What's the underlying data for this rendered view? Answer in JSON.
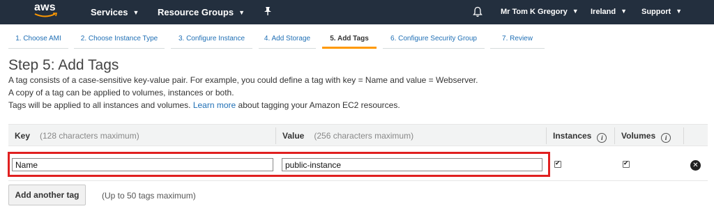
{
  "topnav": {
    "logo": "aws",
    "services": "Services",
    "resource_groups": "Resource Groups",
    "pin_icon": "pin-icon",
    "bell_icon": "bell-icon",
    "user": "Mr Tom K Gregory",
    "region": "Ireland",
    "support": "Support"
  },
  "tabs": [
    {
      "label": "1. Choose AMI"
    },
    {
      "label": "2. Choose Instance Type"
    },
    {
      "label": "3. Configure Instance"
    },
    {
      "label": "4. Add Storage"
    },
    {
      "label": "5. Add Tags"
    },
    {
      "label": "6. Configure Security Group"
    },
    {
      "label": "7. Review"
    }
  ],
  "heading": "Step 5: Add Tags",
  "description": {
    "line1": "A tag consists of a case-sensitive key-value pair. For example, you could define a tag with key = Name and value = Webserver.",
    "line2": "A copy of a tag can be applied to volumes, instances or both.",
    "line3_pre": "Tags will be applied to all instances and volumes.",
    "line3_link": "Learn more",
    "line3_post": "about tagging your Amazon EC2 resources."
  },
  "table": {
    "key_header": "Key",
    "key_hint": "(128 characters maximum)",
    "value_header": "Value",
    "value_hint": "(256 characters maximum)",
    "instances_header": "Instances",
    "volumes_header": "Volumes",
    "info_glyph": "i",
    "rows": [
      {
        "key": "Name",
        "value": "public-instance",
        "instances": true,
        "volumes": true
      }
    ]
  },
  "add_button": "Add another tag",
  "add_hint": "(Up to 50 tags maximum)",
  "colors": {
    "nav_bg": "#232f3e",
    "active_tab_underline": "#ff9900",
    "link": "#1f6fb5",
    "highlight": "#e02020"
  }
}
